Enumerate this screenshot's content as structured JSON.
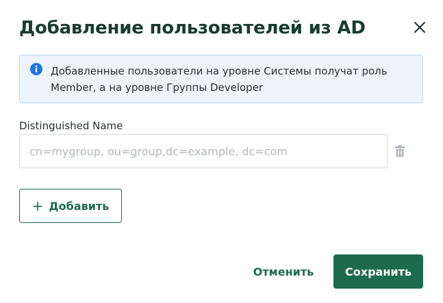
{
  "dialog": {
    "title": "Добавление пользователей из AD",
    "close_icon": "close-icon"
  },
  "info": {
    "icon": "info-icon",
    "text": "Добавленные пользователи на уровне Системы получат роль Member, а на уровне Группы Developer"
  },
  "form": {
    "label": "Distinguished Name",
    "input_value": "",
    "input_placeholder": "cn=mygroup, ou=group,dc=example, dc=com",
    "delete_icon": "trash-icon"
  },
  "actions": {
    "add_icon": "plus-icon",
    "add_label": "Добавить",
    "cancel_label": "Отменить",
    "save_label": "Сохранить"
  },
  "colors": {
    "brand": "#1d6b4f",
    "title": "#173d2f",
    "info_bg": "#edf3fb",
    "info_icon": "#1f78e0"
  }
}
